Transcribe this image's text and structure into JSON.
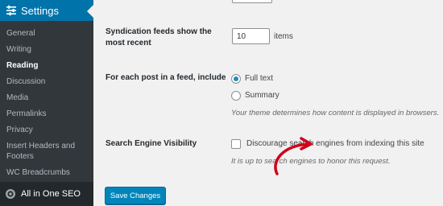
{
  "sidebar": {
    "settings_label": "Settings",
    "items": [
      {
        "label": "General"
      },
      {
        "label": "Writing"
      },
      {
        "label": "Reading"
      },
      {
        "label": "Discussion"
      },
      {
        "label": "Media"
      },
      {
        "label": "Permalinks"
      },
      {
        "label": "Privacy"
      },
      {
        "label": "Insert Headers and Footers"
      },
      {
        "label": "WC Breadcrumbs"
      }
    ],
    "current_item": "Reading",
    "aioseo_label": "All in One SEO"
  },
  "main": {
    "syndication": {
      "label": "Syndication feeds show the most recent",
      "value": "10",
      "suffix": "items"
    },
    "feed_content": {
      "label": "For each post in a feed, include",
      "options": [
        {
          "label": "Full text",
          "checked": true
        },
        {
          "label": "Summary",
          "checked": false
        }
      ],
      "description": "Your theme determines how content is displayed in browsers."
    },
    "search_visibility": {
      "label": "Search Engine Visibility",
      "checkbox_label": "Discourage search engines from indexing this site",
      "checked": false,
      "description": "It is up to search engines to honor this request."
    },
    "save_label": "Save Changes"
  },
  "colors": {
    "accent": "#0073aa",
    "sidebar_bg": "#23282d",
    "submenu_bg": "#32373c",
    "annotation_arrow": "#d0021b"
  },
  "icons": {
    "settings": "settings-sliders-icon",
    "aioseo": "aioseo-gear-icon"
  }
}
